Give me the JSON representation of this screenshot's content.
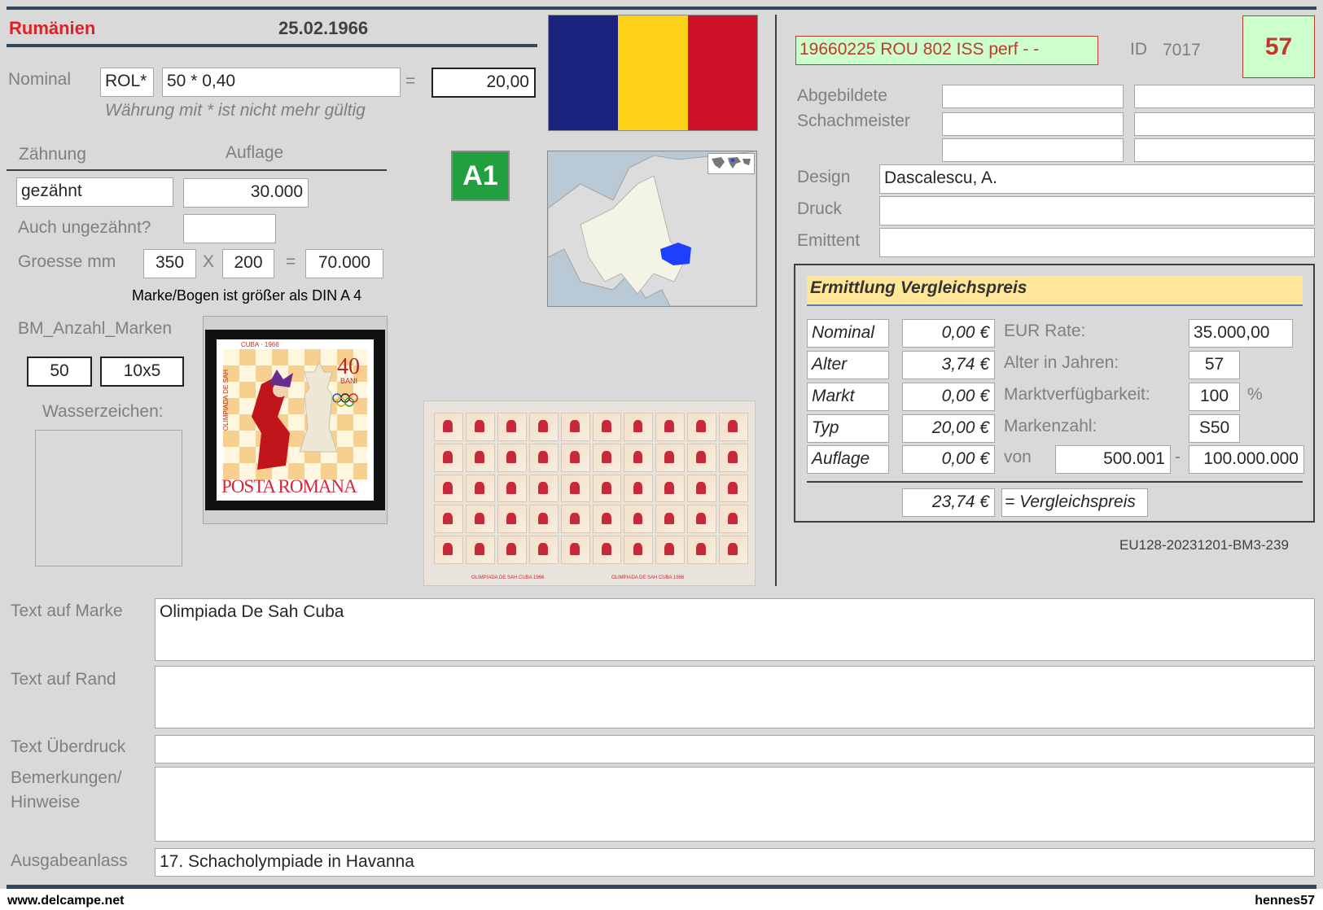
{
  "header": {
    "country": "Rumänien",
    "date": "25.02.1966"
  },
  "nominal": {
    "label": "Nominal",
    "currency": "ROL*",
    "formula": "50 * 0,40",
    "equals": "=",
    "value": "20,00",
    "note": "Währung mit * ist nicht mehr gültig"
  },
  "perforation": {
    "zahnung_label": "Zähnung",
    "auflage_label": "Auflage",
    "zahnung_value": "gezähnt",
    "auflage_value": "30.000",
    "imperf_label": "Auch ungezähnt?",
    "imperf_value": ""
  },
  "size": {
    "label": "Groesse mm",
    "width": "350",
    "x": "X",
    "height": "200",
    "equals": "=",
    "area": "70.000",
    "note": "Marke/Bogen ist größer als DIN A 4"
  },
  "bm": {
    "label": "BM_Anzahl_Marken",
    "count": "50",
    "layout": "10x5"
  },
  "watermark": {
    "label": "Wasserzeichen:"
  },
  "badge": {
    "a1": "A1"
  },
  "stamp": {
    "header": "CUBA · 1966",
    "value": "40",
    "unit": "BANI",
    "side": "OLIMPIADA DE SAH",
    "bottom": "POSTA ROMANA"
  },
  "sheet": {
    "caption_left": "OLIMPIADA DE SAH CUBA 1966",
    "caption_right": "OLIMPIADA DE SAH CUBA 1966"
  },
  "right": {
    "code": "19660225 ROU 802 ISS perf - -",
    "id_label": "ID",
    "id_value": "7017",
    "number": "57",
    "chess_label_1": "Abgebildete",
    "chess_label_2": "Schachmeister",
    "design_label": "Design",
    "design_value": "Dascalescu, A.",
    "druck_label": "Druck",
    "druck_value": "",
    "emittent_label": "Emittent",
    "emittent_value": "",
    "reference": "EU128-20231201-BM3-239"
  },
  "price": {
    "title": "Ermittlung Vergleichspreis",
    "rows": [
      {
        "label": "Nominal",
        "value": "0,00 €"
      },
      {
        "label": "Alter",
        "value": "3,74 €"
      },
      {
        "label": "Markt",
        "value": "0,00 €"
      },
      {
        "label": "Typ",
        "value": "20,00 €"
      },
      {
        "label": "Auflage",
        "value": "0,00 €"
      }
    ],
    "eur_rate_label": "EUR Rate:",
    "eur_rate_value": "35.000,00",
    "age_label": "Alter in Jahren:",
    "age_value": "57",
    "market_label": "Marktverfügbarkeit:",
    "market_value": "100",
    "percent": "%",
    "count_label": "Markenzahl:",
    "count_value": "S50",
    "von_label": "von",
    "von_from": "500.001",
    "dash": "-",
    "von_to": "100.000.000",
    "total": "23,74 €",
    "total_label": "= Vergleichspreis"
  },
  "texts": {
    "marke_label": "Text auf Marke",
    "marke_value": "Olimpiada De Sah Cuba",
    "rand_label": "Text auf Rand",
    "rand_value": "",
    "ueberdruck_label": "Text Überdruck",
    "ueberdruck_value": "",
    "bemerkungen_label_1": "Bemerkungen/",
    "bemerkungen_label_2": "Hinweise",
    "bemerkungen_value": "",
    "anlass_label": "Ausgabeanlass",
    "anlass_value": "17. Schacholympiade in Havanna"
  },
  "footer": {
    "left": "www.delcampe.net",
    "right": "hennes57"
  },
  "colors": {
    "panel": "#d9d9d9",
    "country_red": "#e31e24",
    "flag_blue": "#1a237e",
    "flag_yellow": "#fcd116",
    "flag_red": "#ce1126",
    "badge_green": "#22a040",
    "code_bg": "#ccffcc",
    "price_title_bg": "#ffe699"
  }
}
